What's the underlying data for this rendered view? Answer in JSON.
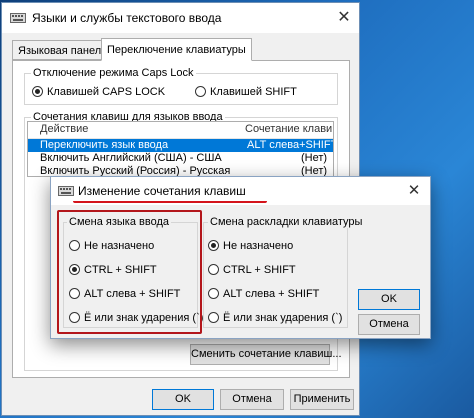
{
  "window": {
    "title": "Языки и службы текстового ввода",
    "close_glyph": "✕"
  },
  "tabs": [
    {
      "label": "Языковая панель",
      "active": false
    },
    {
      "label": "Переключение клавиатуры",
      "active": true
    }
  ],
  "capslock": {
    "group_label": "Отключение режима Caps Lock",
    "options": [
      {
        "label": "Клавишей CAPS LOCK",
        "checked": true
      },
      {
        "label": "Клавишей SHIFT",
        "checked": false
      }
    ]
  },
  "hotkeys": {
    "group_label": "Сочетания клавиш для языков ввода",
    "columns": [
      "Действие",
      "Сочетание клавиш"
    ],
    "rows": [
      {
        "action": "Переключить язык ввода",
        "keys": "ALT слева+SHIFT",
        "selected": true
      },
      {
        "action": "Включить Английский (США) - США",
        "keys": "(Нет)",
        "selected": false
      },
      {
        "action": "Включить Русский (Россия) - Русская",
        "keys": "(Нет)",
        "selected": false
      }
    ],
    "change_button": "Сменить сочетание клавиш..."
  },
  "footer": {
    "ok": "OK",
    "cancel": "Отмена",
    "apply": "Применить"
  },
  "dialog": {
    "title": "Изменение сочетания клавиш",
    "close_glyph": "✕",
    "input_lang": {
      "label": "Смена языка ввода",
      "options": [
        {
          "label": "Не назначено",
          "checked": false
        },
        {
          "label": "CTRL + SHIFT",
          "checked": true
        },
        {
          "label": "ALT слева + SHIFT",
          "checked": false
        },
        {
          "label": "Ё или знак ударения (`)",
          "checked": false
        }
      ]
    },
    "layout": {
      "label": "Смена раскладки клавиатуры",
      "options": [
        {
          "label": "Не назначено",
          "checked": true
        },
        {
          "label": "CTRL + SHIFT",
          "checked": false
        },
        {
          "label": "ALT слева + SHIFT",
          "checked": false
        },
        {
          "label": "Ё или знак ударения (`)",
          "checked": false
        }
      ]
    },
    "ok": "OK",
    "cancel": "Отмена"
  },
  "colors": {
    "selection": "#0078d7",
    "annotation_red": "#d4141b"
  }
}
